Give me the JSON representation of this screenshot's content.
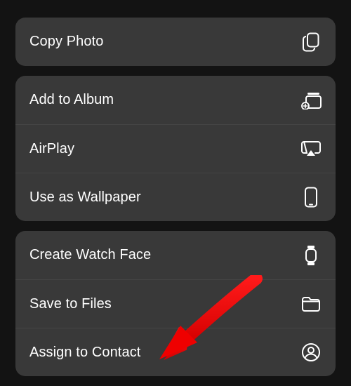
{
  "groups": [
    {
      "items": [
        {
          "label": "Copy Photo",
          "icon": "copy-icon"
        }
      ]
    },
    {
      "items": [
        {
          "label": "Add to Album",
          "icon": "add-to-album-icon"
        },
        {
          "label": "AirPlay",
          "icon": "airplay-icon"
        },
        {
          "label": "Use as Wallpaper",
          "icon": "phone-icon"
        }
      ]
    },
    {
      "items": [
        {
          "label": "Create Watch Face",
          "icon": "watch-icon"
        },
        {
          "label": "Save to Files",
          "icon": "folder-icon"
        },
        {
          "label": "Assign to Contact",
          "icon": "contact-icon"
        }
      ]
    }
  ],
  "annotation": {
    "target": "assign-to-contact"
  }
}
